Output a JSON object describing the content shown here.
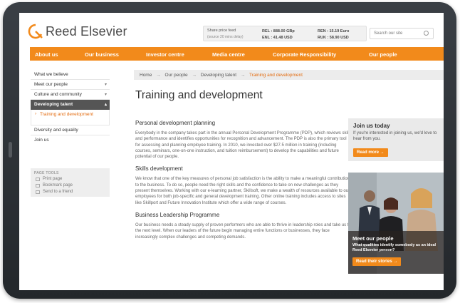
{
  "header": {
    "logo_text": "Reed Elsevier",
    "share": {
      "title": "Share price feed",
      "subtitle": "(source 20 mins delay)",
      "col1": [
        "REL : 888.00 GBp",
        "ENL : 41.48 USD"
      ],
      "col2": [
        "REN : 15.19 Euro",
        "RUK : 58.90 USD"
      ]
    },
    "search_placeholder": "Search our site"
  },
  "nav": [
    "About us",
    "Our business",
    "Investor centre",
    "Media centre",
    "Corporate Responsibility",
    "Our people"
  ],
  "sidebar": {
    "items": [
      {
        "label": "What we believe",
        "caret": ""
      },
      {
        "label": "Meet our people",
        "caret": "▾"
      },
      {
        "label": "Culture and community",
        "caret": "▾"
      },
      {
        "label": "Developing talent",
        "caret": "▴"
      }
    ],
    "sub_item": "Training and development",
    "items_after": [
      "Diversity and equality",
      "Join us"
    ]
  },
  "page_tools": {
    "title": "PAGE TOOLS",
    "items": [
      "Print page",
      "Bookmark page",
      "Send to a friend"
    ]
  },
  "breadcrumb": {
    "items": [
      "Home",
      "Our people",
      "Developing talent"
    ],
    "separator": "→",
    "current": "Training and development"
  },
  "page_title": "Training and development",
  "sections": [
    {
      "heading": "Personal development planning",
      "text": "Everybody in the company takes part in the annual Personal Development Programme (PDP), which reviews skills and performance and identifies opportunities for recognition and advancement. The PDP is also the primary tool for assessing and planning employee training. In 2010, we invested over $27.5 million in training (including courses, seminars, one-on-one instruction, and tuition reimbursement) to develop the capabilities and future potential of our people."
    },
    {
      "heading": "Skills development",
      "text": "We know that one of the key measures of personal job satisfaction is the ability to make a meaningful contribution to the business. To do so, people need the right skills and the confidence to take on new challenges as they present themselves. Working with our e-learning partner, Skillsoft, we make a wealth of resources available to our employees for both job-specific and general development training. Other online training includes access to sites like Skillport and Future Innovation Institute which offer a wide range of courses."
    },
    {
      "heading": "Business Leadership Programme",
      "text": "Our business needs a steady supply of proven performers who are able to thrive in leadership roles and take us to the next level. When our leaders of the future begin managing entire functions or businesses, they face increasingly complex challenges and competing demands."
    }
  ],
  "join": {
    "title": "Join us today",
    "text": "If you're interested in joining us, we'd love to hear from you.",
    "button": "Read more →"
  },
  "meet": {
    "title": "Meet our people",
    "text": "What qualities identify somebody as an ideal Reed Elsevier person?",
    "button": "Read their stories →"
  },
  "colors": {
    "accent": "#f28a1b",
    "frame": "#2c3035"
  }
}
